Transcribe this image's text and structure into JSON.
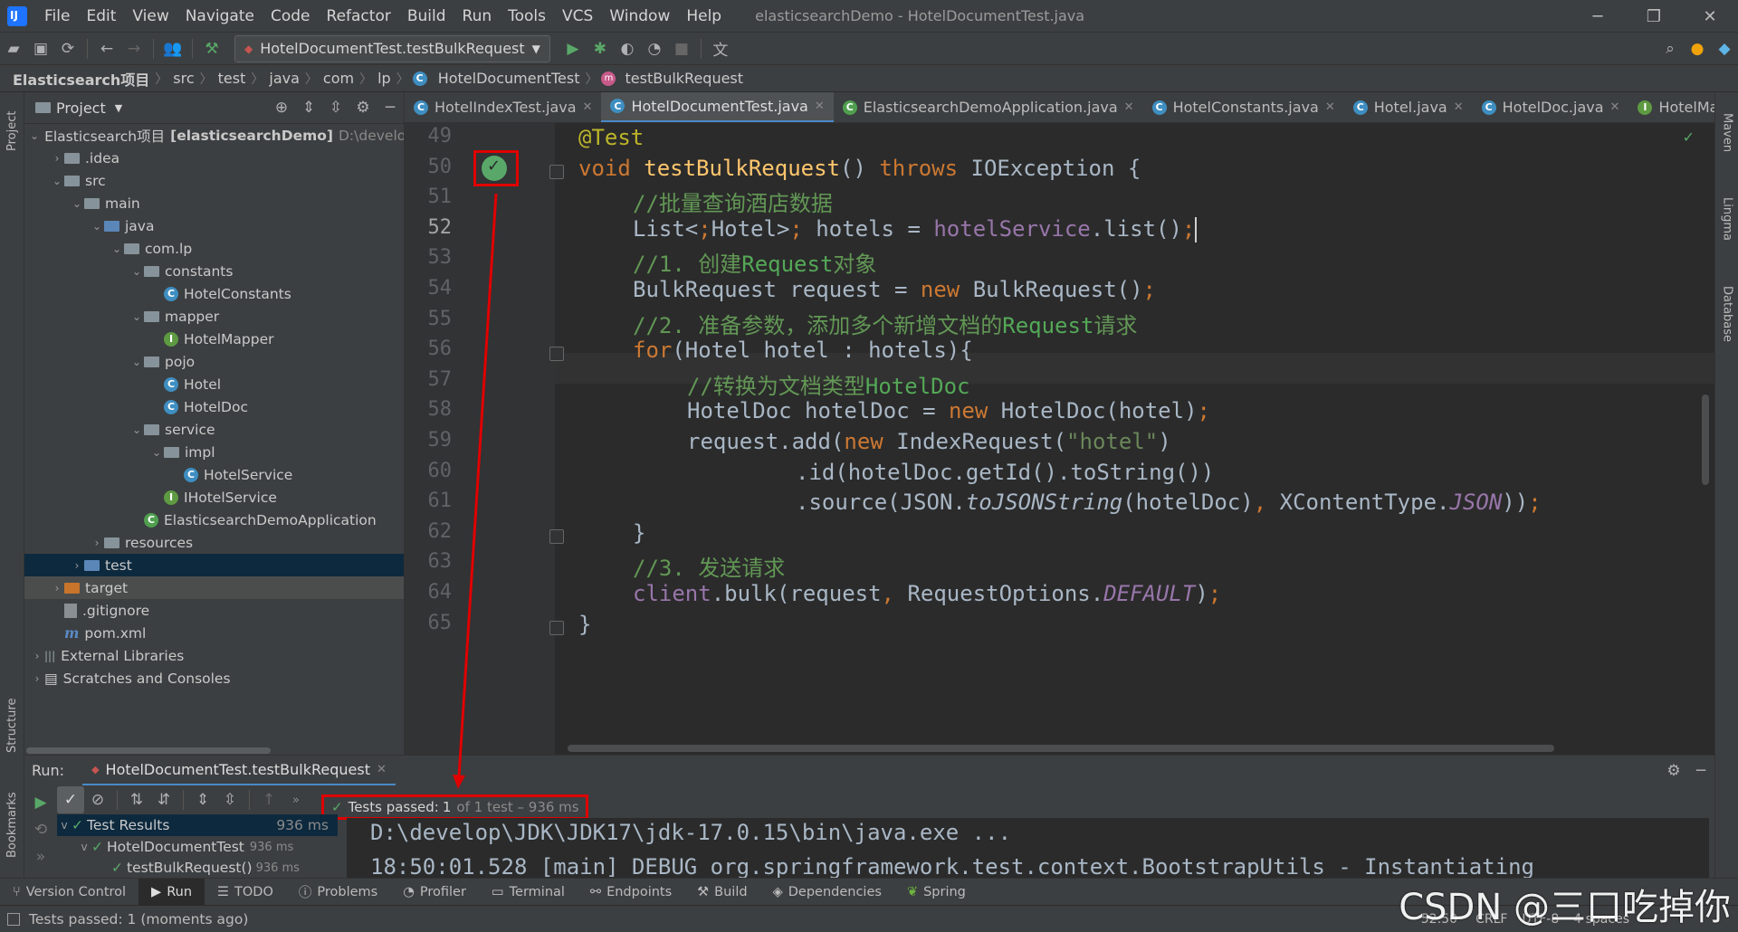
{
  "menu": {
    "items": [
      "File",
      "Edit",
      "View",
      "Navigate",
      "Code",
      "Refactor",
      "Build",
      "Run",
      "Tools",
      "VCS",
      "Window",
      "Help"
    ],
    "title": "elasticsearchDemo - HotelDocumentTest.java"
  },
  "toolbar": {
    "run_config": "HotelDocumentTest.testBulkRequest"
  },
  "breadcrumb": [
    "Elasticsearch项目",
    "src",
    "test",
    "java",
    "com",
    "lp",
    "HotelDocumentTest",
    "testBulkRequest"
  ],
  "project": {
    "header": "Project",
    "tree": [
      {
        "depth": 0,
        "arrow": "v",
        "icon": "folder",
        "label": "Elasticsearch项目",
        "bold": "[elasticsearchDemo]",
        "path": "D:\\develop"
      },
      {
        "depth": 1,
        "arrow": ">",
        "icon": "folder",
        "label": ".idea"
      },
      {
        "depth": 1,
        "arrow": "v",
        "icon": "folder",
        "label": "src"
      },
      {
        "depth": 2,
        "arrow": "v",
        "icon": "folder",
        "label": "main"
      },
      {
        "depth": 3,
        "arrow": "v",
        "icon": "folder-blue",
        "label": "java"
      },
      {
        "depth": 4,
        "arrow": "v",
        "icon": "folder",
        "label": "com.lp"
      },
      {
        "depth": 5,
        "arrow": "v",
        "icon": "folder",
        "label": "constants"
      },
      {
        "depth": 6,
        "arrow": "",
        "icon": "class",
        "label": "HotelConstants"
      },
      {
        "depth": 5,
        "arrow": "v",
        "icon": "folder",
        "label": "mapper"
      },
      {
        "depth": 6,
        "arrow": "",
        "icon": "interface",
        "label": "HotelMapper"
      },
      {
        "depth": 5,
        "arrow": "v",
        "icon": "folder",
        "label": "pojo"
      },
      {
        "depth": 6,
        "arrow": "",
        "icon": "class",
        "label": "Hotel"
      },
      {
        "depth": 6,
        "arrow": "",
        "icon": "class",
        "label": "HotelDoc"
      },
      {
        "depth": 5,
        "arrow": "v",
        "icon": "folder",
        "label": "service"
      },
      {
        "depth": 6,
        "arrow": "v",
        "icon": "folder",
        "label": "impl"
      },
      {
        "depth": 7,
        "arrow": "",
        "icon": "class",
        "label": "HotelService"
      },
      {
        "depth": 6,
        "arrow": "",
        "icon": "interface",
        "label": "IHotelService"
      },
      {
        "depth": 5,
        "arrow": "",
        "icon": "spring",
        "label": "ElasticsearchDemoApplication"
      },
      {
        "depth": 3,
        "arrow": ">",
        "icon": "folder",
        "label": "resources"
      },
      {
        "depth": 2,
        "arrow": ">",
        "icon": "folder-blue",
        "label": "test",
        "selected": true
      },
      {
        "depth": 1,
        "arrow": ">",
        "icon": "folder-orange",
        "label": "target",
        "selected_gray": true
      },
      {
        "depth": 1,
        "arrow": "",
        "icon": "file",
        "label": ".gitignore"
      },
      {
        "depth": 1,
        "arrow": "",
        "icon": "maven",
        "label": "pom.xml"
      },
      {
        "depth": 0,
        "arrow": ">",
        "icon": "library",
        "label": "External Libraries"
      },
      {
        "depth": 0,
        "arrow": ">",
        "icon": "scratch",
        "label": "Scratches and Consoles"
      }
    ]
  },
  "tabs": [
    {
      "label": "HotelIndexTest.java",
      "active": false
    },
    {
      "label": "HotelDocumentTest.java",
      "active": true
    },
    {
      "label": "ElasticsearchDemoApplication.java",
      "active": false
    },
    {
      "label": "HotelConstants.java",
      "active": false
    },
    {
      "label": "Hotel.java",
      "active": false
    },
    {
      "label": "HotelDoc.java",
      "active": false
    },
    {
      "label": "HotelMa",
      "active": false
    }
  ],
  "editor": {
    "current_line": 52,
    "lines": [
      {
        "n": "49",
        "code": "@Test"
      },
      {
        "n": "50",
        "code": "void testBulkRequest() throws IOException {"
      },
      {
        "n": "51",
        "code": "//批量查询酒店数据"
      },
      {
        "n": "52",
        "code": "List<Hotel> hotels = hotelService.list();"
      },
      {
        "n": "53",
        "code": "//1. 创建Request对象"
      },
      {
        "n": "54",
        "code": "BulkRequest request = new BulkRequest();"
      },
      {
        "n": "55",
        "code": "//2. 准备参数，添加多个新增文档的Request请求"
      },
      {
        "n": "56",
        "code": "for(Hotel hotel : hotels){"
      },
      {
        "n": "57",
        "code": "//转换为文档类型HotelDoc"
      },
      {
        "n": "58",
        "code": "HotelDoc hotelDoc = new HotelDoc(hotel);"
      },
      {
        "n": "59",
        "code": "request.add(new IndexRequest(\"hotel\")"
      },
      {
        "n": "60",
        "code": ".id(hotelDoc.getId().toString())"
      },
      {
        "n": "61",
        "code": ".source(JSON.toJSONString(hotelDoc), XContentType.JSON));"
      },
      {
        "n": "62",
        "code": "}"
      },
      {
        "n": "63",
        "code": "//3. 发送请求"
      },
      {
        "n": "64",
        "code": "client.bulk(request, RequestOptions.DEFAULT);"
      },
      {
        "n": "65",
        "code": "}"
      }
    ]
  },
  "right_tools": [
    "Maven",
    "Lingma",
    "Database"
  ],
  "left_tools": [
    "Project",
    "Structure",
    "Bookmarks"
  ],
  "run": {
    "label": "Run:",
    "tab": "HotelDocumentTest.testBulkRequest",
    "status_prefix": "Tests passed:",
    "status_count": "1",
    "status_rest": "of 1 test – 936 ms",
    "tree": [
      {
        "label": "Test Results",
        "time": "936 ms",
        "depth": 0
      },
      {
        "label": "HotelDocumentTest",
        "time": "936 ms",
        "depth": 1
      },
      {
        "label": "testBulkRequest()",
        "time": "936 ms",
        "depth": 2
      }
    ],
    "console": [
      "D:\\develop\\JDK\\JDK17\\jdk-17.0.15\\bin\\java.exe ...",
      "18:50:01.528 [main] DEBUG org.springframework.test.context.BootstrapUtils - Instantiating"
    ]
  },
  "bottom_tools": [
    "Version Control",
    "Run",
    "TODO",
    "Problems",
    "Profiler",
    "Terminal",
    "Endpoints",
    "Build",
    "Dependencies",
    "Spring"
  ],
  "status": {
    "message": "Tests passed: 1 (moments ago)",
    "position": "52:50",
    "line_sep": "CRLF",
    "encoding": "UTF-8",
    "indent": "4 spaces"
  },
  "watermark": "CSDN @三口吃掉你",
  "colors": {
    "accent": "#4a88c7",
    "highlight": "#e00000",
    "success": "#59a869"
  }
}
